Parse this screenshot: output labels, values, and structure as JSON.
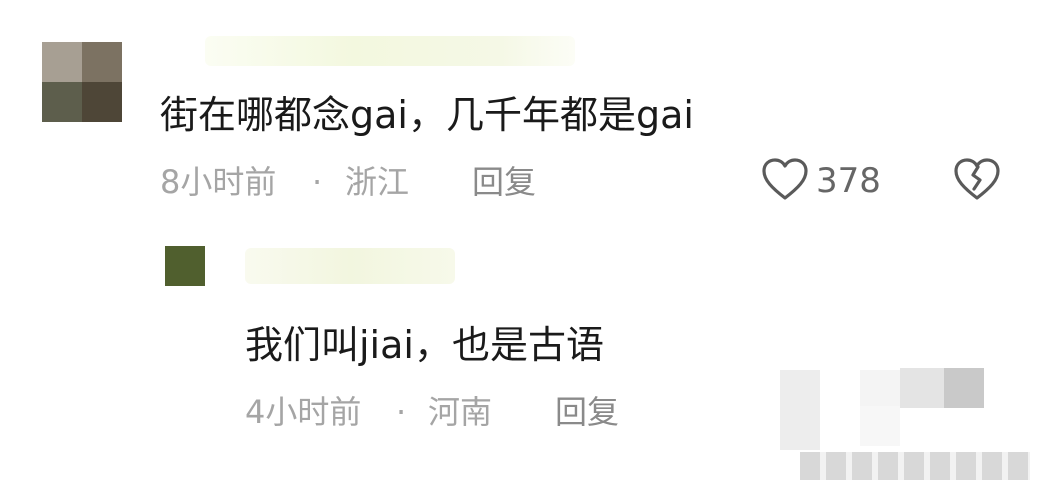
{
  "comments": [
    {
      "text": "街在哪都念gai，几千年都是gai",
      "time": "8小时前",
      "separator": "·",
      "location": "浙江",
      "reply_label": "回复",
      "like_count": "378"
    },
    {
      "text": "我们叫jiai，也是古语",
      "time": "4小时前",
      "separator": "·",
      "location": "河南",
      "reply_label": "回复"
    }
  ],
  "icons": {
    "like": "heart-outline-icon",
    "dislike": "broken-heart-icon"
  }
}
